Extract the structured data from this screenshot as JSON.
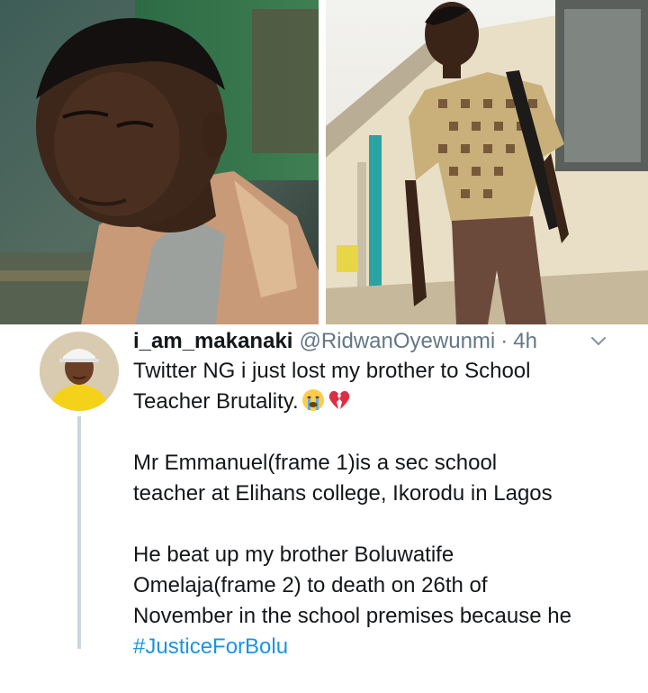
{
  "photos": [
    {
      "icon": "portrait-photo-man"
    },
    {
      "icon": "portrait-photo-schoolboy"
    }
  ],
  "tweet": {
    "display_name": "i_am_makanaki",
    "handle": "@RidwanOyewunmi",
    "separator": "·",
    "time": "4h",
    "paragraphs": [
      {
        "lines": [
          "Twitter NG i just lost my brother to School",
          "Teacher Brutality."
        ],
        "emojis": [
          "crying-face-emoji",
          "broken-heart-emoji"
        ]
      },
      {
        "lines": [
          "Mr Emmanuel(frame 1)is a sec school",
          "teacher at Elihans college, Ikorodu in Lagos"
        ]
      },
      {
        "lines": [
          "He beat up my brother Boluwatife",
          "Omelaja(frame 2) to death on 26th of",
          "November in the school premises because he"
        ]
      }
    ],
    "hashtag": "#JusticeForBolu"
  },
  "colors": {
    "text": "#14171a",
    "muted": "#657786",
    "link": "#1b95e0",
    "thread_line": "#ccd6dd"
  }
}
